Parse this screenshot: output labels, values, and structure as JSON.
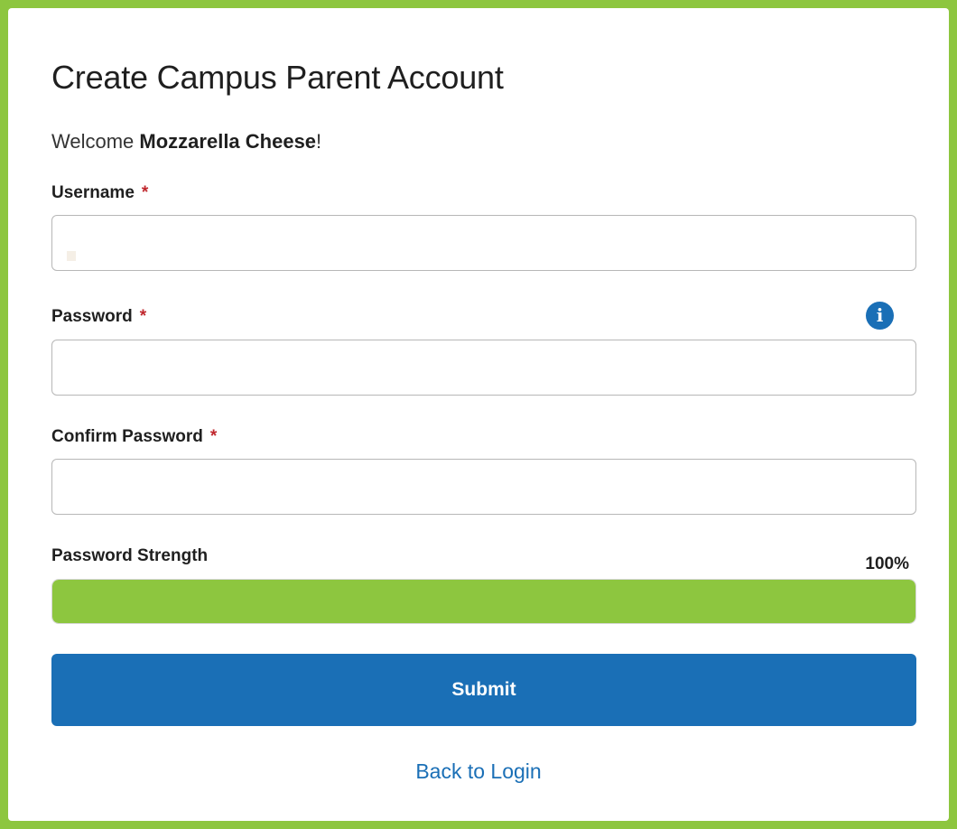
{
  "form": {
    "title": "Create Campus Parent Account",
    "welcome_prefix": "Welcome ",
    "welcome_name": "Mozzarella Cheese",
    "welcome_suffix": "!",
    "required_marker": "*",
    "username": {
      "label": "Username",
      "value": ""
    },
    "password": {
      "label": "Password",
      "value": "",
      "info_icon": "info-icon"
    },
    "confirm_password": {
      "label": "Confirm Password",
      "value": ""
    },
    "strength": {
      "label": "Password Strength",
      "value_text": "100%",
      "fraction": 1.0
    },
    "submit_label": "Submit",
    "back_link_label": "Back to Login"
  },
  "colors": {
    "background": "#8dc63f",
    "primary": "#1a6fb6",
    "required": "#c0272d",
    "strength_fill": "#8dc63f"
  }
}
